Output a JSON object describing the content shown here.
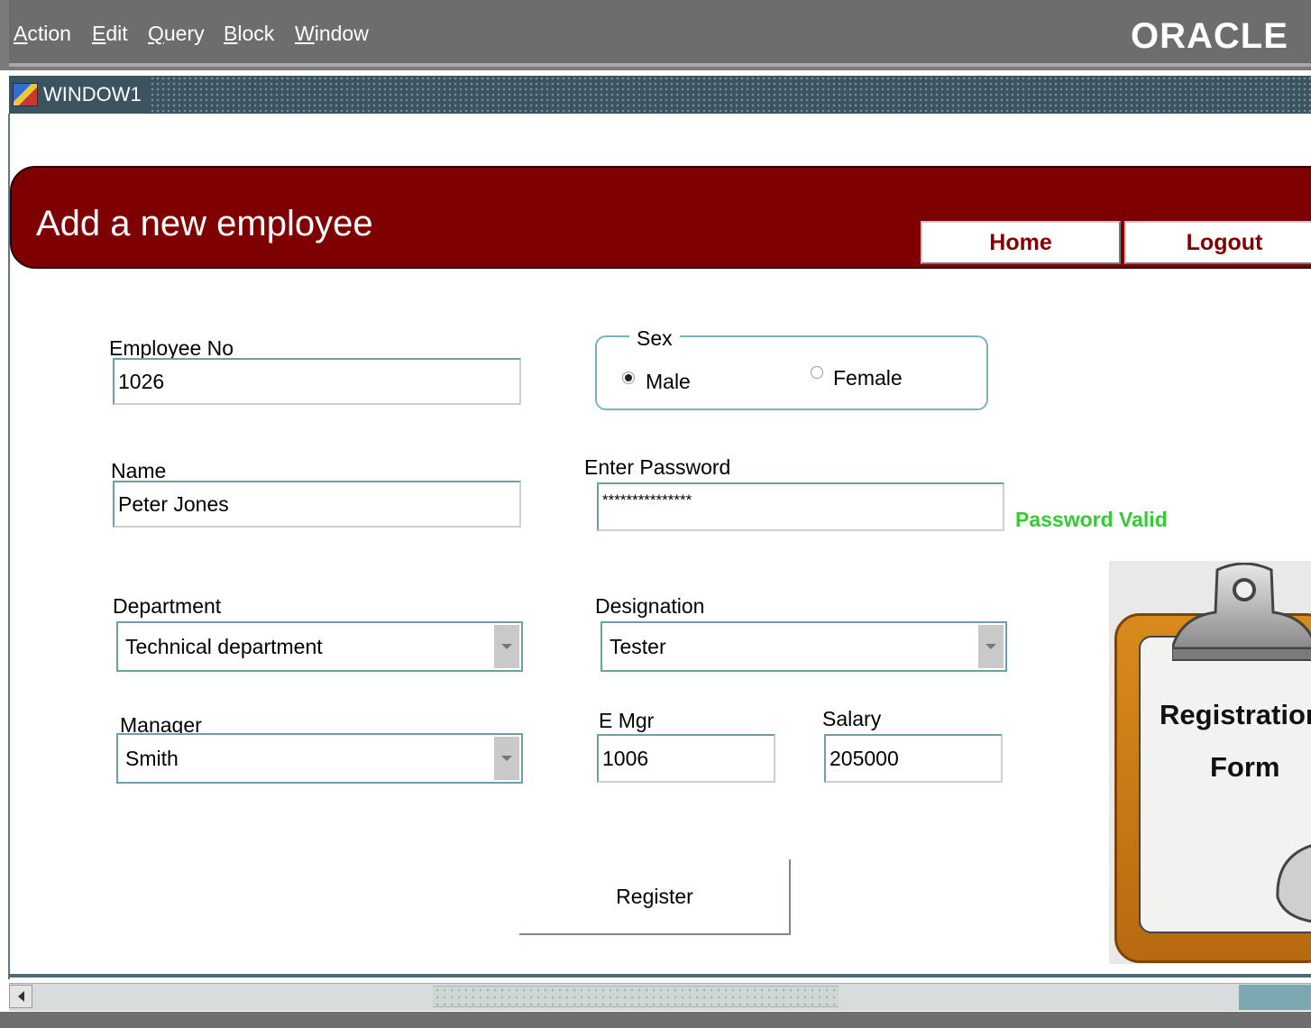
{
  "menubar": {
    "items": [
      {
        "accel": "A",
        "rest": "ction"
      },
      {
        "accel": "E",
        "rest": "dit"
      },
      {
        "accel": "Q",
        "rest": "uery"
      },
      {
        "accel": "B",
        "rest": "lock"
      },
      {
        "accel": "W",
        "rest": "indow"
      }
    ],
    "brand": "ORACLE"
  },
  "window": {
    "title": "WINDOW1"
  },
  "header": {
    "title": "Add a new employee",
    "home_label": "Home",
    "logout_label": "Logout",
    "accent": "#800000"
  },
  "form": {
    "employee_no": {
      "label": "Employee No",
      "value": "1026"
    },
    "sex": {
      "label": "Sex",
      "options": [
        "Male",
        "Female"
      ],
      "selected": "Male"
    },
    "name": {
      "label": "Name",
      "value": "Peter Jones"
    },
    "password": {
      "label": "Enter Password",
      "value": "***************",
      "status": "Password Valid",
      "status_color": "#33cc33"
    },
    "department": {
      "label": "Department",
      "value": "Technical department"
    },
    "designation": {
      "label": "Designation",
      "value": "Tester"
    },
    "manager": {
      "label": "Manager",
      "value": "Smith"
    },
    "e_mgr": {
      "label": "E Mgr",
      "value": "1006"
    },
    "salary": {
      "label": "Salary",
      "value": "205000"
    },
    "register_label": "Register"
  },
  "clipboard": {
    "line1": "Registration",
    "line2": "Form"
  }
}
